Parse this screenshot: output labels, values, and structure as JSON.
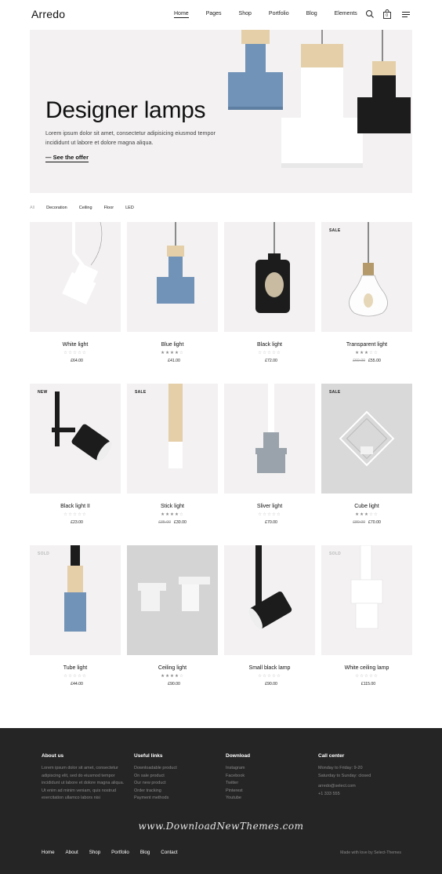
{
  "header": {
    "logo": "Arredo",
    "nav": [
      "Home",
      "Pages",
      "Shop",
      "Portfolio",
      "Blog",
      "Elements"
    ],
    "cart_count": "0"
  },
  "hero": {
    "title": "Designer lamps",
    "text": "Lorem ipsum dolor sit amet, consectetur adipisicing eiusmod tempor incididunt ut labore et dolore magna aliqua.",
    "link": "See the offer"
  },
  "filters": [
    "All",
    "Decoration",
    "Ceiling",
    "Floor",
    "LED"
  ],
  "products": [
    {
      "name": "White light",
      "rating": 0,
      "price": "£64.00",
      "old_price": "",
      "badge": ""
    },
    {
      "name": "Blue light",
      "rating": 4,
      "price": "£41.00",
      "old_price": "",
      "badge": ""
    },
    {
      "name": "Black light",
      "rating": 0,
      "price": "£72.00",
      "old_price": "",
      "badge": ""
    },
    {
      "name": "Transparent light",
      "rating": 3,
      "price": "£55.00",
      "old_price": "£60.00",
      "badge": "SALE"
    },
    {
      "name": "Black light II",
      "rating": 0,
      "price": "£23.00",
      "old_price": "",
      "badge": "NEW"
    },
    {
      "name": "Stick light",
      "rating": 4,
      "price": "£30.00",
      "old_price": "£35.00",
      "badge": "SALE"
    },
    {
      "name": "Sliver light",
      "rating": 0,
      "price": "£70.00",
      "old_price": "",
      "badge": ""
    },
    {
      "name": "Cube light",
      "rating": 3,
      "price": "£70.00",
      "old_price": "£80.00",
      "badge": "SALE"
    },
    {
      "name": "Tube light",
      "rating": 0,
      "price": "£44.00",
      "old_price": "",
      "badge": "SOLD"
    },
    {
      "name": "Ceiling light",
      "rating": 4,
      "price": "£90.00",
      "old_price": "",
      "badge": ""
    },
    {
      "name": "Small black lamp",
      "rating": 0,
      "price": "£90.00",
      "old_price": "",
      "badge": ""
    },
    {
      "name": "White ceiling lamp",
      "rating": 0,
      "price": "£115.00",
      "old_price": "",
      "badge": "SOLD"
    }
  ],
  "footer": {
    "about": {
      "title": "About us",
      "text": "Lorem ipsum dolor sit amet, consectetur adipiscing elit, sed do eiusmod tempor incididunt ut labore et dolore magna aliqua. Ut enim ad minim veniam, quis nostrud exercitation ullamco labors nisi"
    },
    "useful": {
      "title": "Useful links",
      "items": [
        "Downloadable product",
        "On sale product",
        "Our new product",
        "Order tracking",
        "Payment methods"
      ]
    },
    "download": {
      "title": "Download",
      "items": [
        "Instagram",
        "Facebook",
        "Twitter",
        "Pinterest",
        "Youtube"
      ]
    },
    "call": {
      "title": "Call center",
      "items": [
        "Monday to Friday: 9-20",
        "Saturday to Sunday: closed"
      ],
      "email": "arredo@select.com",
      "phone": "+1 333 555"
    },
    "watermark": "www.DownloadNewThemes.com",
    "nav": [
      "Home",
      "About",
      "Shop",
      "Portfolio",
      "Blog",
      "Contact"
    ],
    "credit": "Made with love by Select-Themes"
  },
  "colors": {
    "hero_bg": "#f3f1f1",
    "blue_lamp": "#7193b8",
    "footer_bg": "#252525",
    "wood": "#e4cfa9"
  }
}
